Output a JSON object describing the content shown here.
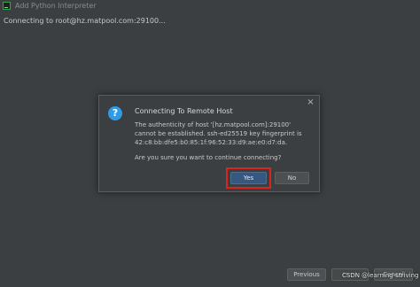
{
  "window": {
    "title": "Add Python Interpreter",
    "status": "Connecting to root@hz.matpool.com:29100..."
  },
  "dialog": {
    "title": "Connecting To Remote Host",
    "message": "The authenticity of host '[hz.matpool.com]:29100' cannot be established. ssh-ed25519 key fingerprint is 42:c8:bb:dfe5:b0:85:1f:96:52:33:d9:ae:e0:d7:da.",
    "question": "Are you sure you want to continue connecting?",
    "yes_label": "Yes",
    "no_label": "No",
    "close_label": "×",
    "icon_glyph": "?"
  },
  "wizard": {
    "previous_label": "Previous",
    "next_label": "Next",
    "cancel_label": "Cancel"
  },
  "watermark": "CSDN @learning-striving",
  "colors": {
    "background": "#3c3f41",
    "accent_blue": "#2f9be7",
    "primary_button": "#365880",
    "highlight_red": "#d9251d"
  }
}
